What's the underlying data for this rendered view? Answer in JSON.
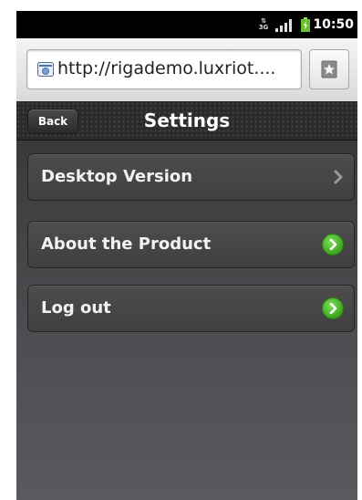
{
  "status_bar": {
    "network_label": "3G",
    "clock": "10:50",
    "icons": [
      "network-3g-icon",
      "signal-strength-icon",
      "battery-charging-icon"
    ]
  },
  "browser": {
    "url": "http://rigademo.luxriot....",
    "favicon_icon": "page-favicon-icon",
    "bookmark_icon": "bookmark-star-icon"
  },
  "header": {
    "back_label": "Back",
    "title": "Settings"
  },
  "menu": {
    "items": [
      {
        "label": "Desktop Version",
        "icon": "chevron-right-icon"
      },
      {
        "label": "About the Product",
        "icon": "green-arrow-circle-icon"
      },
      {
        "label": "Log out",
        "icon": "green-arrow-circle-icon"
      }
    ]
  },
  "colors": {
    "accent_green": "#3ba51f",
    "header_bg": "#2b2b2b",
    "content_bg": "#4e4e52"
  }
}
